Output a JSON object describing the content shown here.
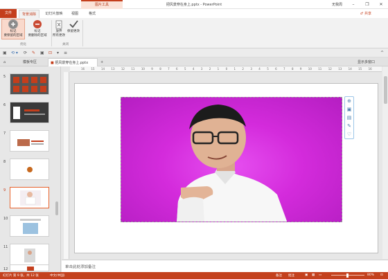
{
  "titlebar": {
    "title": "把风景穿在身上.pptx - PowerPoint",
    "context_group": "图片工具",
    "signin": "无我周",
    "minimize": "–",
    "restore": "❐",
    "close": "✕"
  },
  "tabs": {
    "file": "文件",
    "items": [
      "背景消除",
      "幻灯片放映",
      "视图",
      "格式"
    ],
    "active_index": 0,
    "share": "♂ 共享"
  },
  "ribbon": {
    "buttons": [
      {
        "label1": "标记",
        "label2": "要保留的区域"
      },
      {
        "label1": "标记",
        "label2": "要删除的区域"
      },
      {
        "label1": "放弃",
        "label2": "所有更改"
      },
      {
        "label1": "保留更改",
        "label2": ""
      }
    ],
    "groups": [
      "优化",
      "关闭"
    ]
  },
  "qat": {
    "items": [
      "▣",
      "⟲ ▾",
      "⟳",
      "✎",
      "▣",
      "⊡",
      "▾",
      "≡"
    ],
    "expand": "^"
  },
  "doctabs": {
    "home": "⌂",
    "template_tab": "模板专区",
    "file_tab": "把风景穿在身上.pptx",
    "add": "+",
    "show_all": "显示多窗口"
  },
  "slides": {
    "numbers": [
      "5",
      "6",
      "7",
      "8",
      "9",
      "10",
      "11",
      "12"
    ],
    "selected": "9"
  },
  "ruler": {
    "h_labels": [
      "16",
      "15",
      "14",
      "13",
      "12",
      "11",
      "10",
      "9",
      "8",
      "7",
      "6",
      "5",
      "4",
      "3",
      "2",
      "1",
      "0",
      "1",
      "2",
      "3",
      "4",
      "5",
      "6",
      "7",
      "8",
      "9",
      "10",
      "11",
      "12",
      "13",
      "14",
      "15",
      "16"
    ]
  },
  "side_tools": [
    "⊕",
    "▣",
    "▤",
    "✎",
    "♡"
  ],
  "notes": {
    "placeholder": "单击此处添加备注"
  },
  "status": {
    "slide_info": "幻灯片 第 9 张，共 12 张",
    "language": "中文(中国)",
    "notes_btn": "备注",
    "comments_btn": "批注",
    "zoom": "80%"
  },
  "colors": {
    "accent": "#c43e1c",
    "picture_bg": "#d42bdc"
  }
}
